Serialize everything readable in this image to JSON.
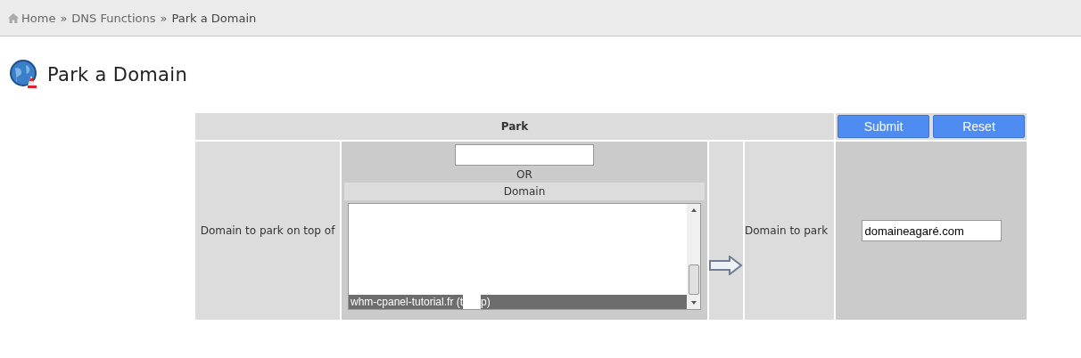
{
  "breadcrumb": [
    {
      "label": "Home",
      "kind": "home"
    },
    {
      "label": "DNS Functions",
      "kind": "link"
    },
    {
      "label": "Park a Domain",
      "kind": "current"
    }
  ],
  "breadcrumb_separator": "»",
  "page_title": "Park a Domain",
  "form": {
    "header": "Park",
    "buttons": [
      "Submit",
      "Reset"
    ],
    "target_label": "Domain to park on top of",
    "or_label": "OR",
    "domain_list_header": "Domain",
    "domain_list": [
      {
        "text_before": "whm-cpanel-tutorial.fr (t",
        "text_after": "p)",
        "redacted": true,
        "selected": true
      }
    ],
    "park_label": "Domain to park",
    "park_field": {
      "value": "domaineagaré.com"
    }
  }
}
